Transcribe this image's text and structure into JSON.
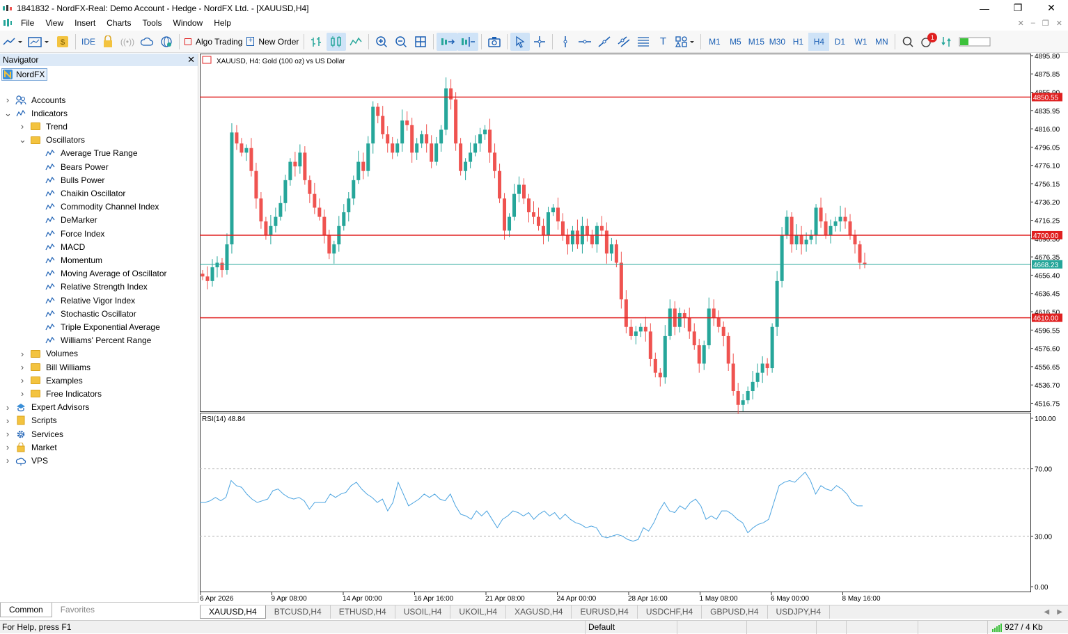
{
  "window": {
    "title": "1841832 - NordFX-Real: Demo Account - Hedge - NordFX Ltd. - [XAUUSD,H4]"
  },
  "menu": [
    "File",
    "View",
    "Insert",
    "Charts",
    "Tools",
    "Window",
    "Help"
  ],
  "toolbar": {
    "ide_label": "IDE",
    "algo_trading_label": "Algo Trading",
    "new_order_label": "New Order",
    "timeframes": [
      "M1",
      "M5",
      "M15",
      "M30",
      "H1",
      "H4",
      "D1",
      "W1",
      "MN"
    ],
    "active_timeframe": "H4",
    "notifications_count": "1"
  },
  "navigator": {
    "title": "Navigator",
    "root": "NordFX",
    "items": [
      {
        "label": "Accounts",
        "level": 1,
        "icon": "accounts-icon",
        "expander": ">"
      },
      {
        "label": "Indicators",
        "level": 1,
        "icon": "indicator-icon",
        "expander": "v"
      },
      {
        "label": "Trend",
        "level": 2,
        "icon": "folder-icon",
        "expander": ">"
      },
      {
        "label": "Oscillators",
        "level": 2,
        "icon": "folder-icon",
        "expander": "v"
      },
      {
        "label": "Average True Range",
        "level": 3,
        "icon": "indicator-icon",
        "expander": ""
      },
      {
        "label": "Bears Power",
        "level": 3,
        "icon": "indicator-icon",
        "expander": ""
      },
      {
        "label": "Bulls Power",
        "level": 3,
        "icon": "indicator-icon",
        "expander": ""
      },
      {
        "label": "Chaikin Oscillator",
        "level": 3,
        "icon": "indicator-icon",
        "expander": ""
      },
      {
        "label": "Commodity Channel Index",
        "level": 3,
        "icon": "indicator-icon",
        "expander": ""
      },
      {
        "label": "DeMarker",
        "level": 3,
        "icon": "indicator-icon",
        "expander": ""
      },
      {
        "label": "Force Index",
        "level": 3,
        "icon": "indicator-icon",
        "expander": ""
      },
      {
        "label": "MACD",
        "level": 3,
        "icon": "indicator-icon",
        "expander": ""
      },
      {
        "label": "Momentum",
        "level": 3,
        "icon": "indicator-icon",
        "expander": ""
      },
      {
        "label": "Moving Average of Oscillator",
        "level": 3,
        "icon": "indicator-icon",
        "expander": ""
      },
      {
        "label": "Relative Strength Index",
        "level": 3,
        "icon": "indicator-icon",
        "expander": ""
      },
      {
        "label": "Relative Vigor Index",
        "level": 3,
        "icon": "indicator-icon",
        "expander": ""
      },
      {
        "label": "Stochastic Oscillator",
        "level": 3,
        "icon": "indicator-icon",
        "expander": ""
      },
      {
        "label": "Triple Exponential Average",
        "level": 3,
        "icon": "indicator-icon",
        "expander": ""
      },
      {
        "label": "Williams' Percent Range",
        "level": 3,
        "icon": "indicator-icon",
        "expander": ""
      },
      {
        "label": "Volumes",
        "level": 2,
        "icon": "folder-icon",
        "expander": ">"
      },
      {
        "label": "Bill Williams",
        "level": 2,
        "icon": "folder-icon",
        "expander": ">"
      },
      {
        "label": "Examples",
        "level": 2,
        "icon": "folder-icon",
        "expander": ">"
      },
      {
        "label": "Free Indicators",
        "level": 2,
        "icon": "folder-icon",
        "expander": ">"
      },
      {
        "label": "Expert Advisors",
        "level": 1,
        "icon": "expert-icon",
        "expander": ">"
      },
      {
        "label": "Scripts",
        "level": 1,
        "icon": "script-icon",
        "expander": ">"
      },
      {
        "label": "Services",
        "level": 1,
        "icon": "gear-icon",
        "expander": ">"
      },
      {
        "label": "Market",
        "level": 1,
        "icon": "bag-icon",
        "expander": ">"
      },
      {
        "label": "VPS",
        "level": 1,
        "icon": "cloud-icon",
        "expander": ">"
      }
    ],
    "tabs": [
      "Common",
      "Favorites"
    ]
  },
  "chart": {
    "header": "XAUUSD, H4:  Gold (100 oz) vs US Dollar",
    "rsi_label": "RSI(14) 48.84",
    "price_axis": [
      "4895.80",
      "4875.85",
      "4855.90",
      "4835.95",
      "4816.00",
      "4796.05",
      "4776.10",
      "4756.15",
      "4736.20",
      "4716.25",
      "4696.30",
      "4676.35",
      "4656.40",
      "4636.45",
      "4616.50",
      "4596.55",
      "4576.60",
      "4556.65",
      "4536.70",
      "4516.75"
    ],
    "rsi_axis": [
      "100.00",
      "70.00",
      "30.00",
      "0.00"
    ],
    "time_axis": [
      "6 Apr 2026",
      "9 Apr 08:00",
      "14 Apr 00:00",
      "16 Apr 16:00",
      "21 Apr 08:00",
      "24 Apr 00:00",
      "28 Apr 16:00",
      "1 May 08:00",
      "6 May 00:00",
      "8 May 16:00"
    ],
    "hlines": [
      {
        "label": "4850.55",
        "price": 4850.55,
        "color": "#e02020"
      },
      {
        "label": "4700.00",
        "price": 4700.0,
        "color": "#e02020"
      },
      {
        "label": "4610.00",
        "price": 4610.0,
        "color": "#e02020"
      }
    ],
    "bid_line": {
      "label": "4668.23",
      "price": 4668.23,
      "color": "#26a69a"
    },
    "colors": {
      "up": "#26a69a",
      "down": "#ef5350",
      "rsi": "#4aa3e0"
    }
  },
  "chart_data": {
    "type": "candlestick",
    "symbol": "XAUUSD",
    "timeframe": "H4",
    "ylim": [
      4508,
      4898
    ],
    "close_path": [
      4655,
      4650,
      4665,
      4670,
      4662,
      4690,
      4812,
      4800,
      4790,
      4795,
      4770,
      4740,
      4715,
      4700,
      4710,
      4720,
      4735,
      4760,
      4780,
      4775,
      4790,
      4760,
      4745,
      4730,
      4720,
      4700,
      4680,
      4690,
      4710,
      4725,
      4740,
      4760,
      4780,
      4770,
      4800,
      4840,
      4830,
      4810,
      4800,
      4790,
      4800,
      4825,
      4820,
      4790,
      4800,
      4810,
      4800,
      4780,
      4800,
      4815,
      4860,
      4848,
      4800,
      4770,
      4780,
      4790,
      4800,
      4810,
      4815,
      4790,
      4770,
      4740,
      4705,
      4720,
      4745,
      4755,
      4740,
      4725,
      4720,
      4710,
      4700,
      4725,
      4730,
      4715,
      4700,
      4690,
      4705,
      4690,
      4710,
      4700,
      4690,
      4710,
      4705,
      4680,
      4690,
      4670,
      4630,
      4600,
      4590,
      4595,
      4600,
      4595,
      4565,
      4550,
      4545,
      4590,
      4620,
      4600,
      4615,
      4610,
      4595,
      4580,
      4560,
      4580,
      4620,
      4610,
      4600,
      4590,
      4560,
      4530,
      4515,
      4520,
      4530,
      4540,
      4550,
      4560,
      4555,
      4600,
      4650,
      4700,
      4720,
      4690,
      4700,
      4690,
      4695,
      4700,
      4730,
      4715,
      4700,
      4710,
      4715,
      4720,
      4715,
      4700,
      4690,
      4670,
      4668
    ],
    "rsi_values": [
      50,
      50,
      51,
      53,
      51,
      53,
      63,
      60,
      59,
      55,
      52,
      50,
      51,
      52,
      57,
      58,
      55,
      53,
      52,
      53,
      51,
      46,
      50,
      50,
      50,
      55,
      53,
      55,
      56,
      60,
      62,
      58,
      55,
      53,
      50,
      52,
      45,
      50,
      62,
      55,
      48,
      50,
      52,
      55,
      53,
      55,
      52,
      51,
      55,
      48,
      43,
      42,
      40,
      45,
      42,
      45,
      40,
      35,
      40,
      42,
      45,
      44,
      42,
      44,
      40,
      43,
      45,
      42,
      44,
      40,
      43,
      40,
      38,
      37,
      35,
      36,
      35,
      30,
      29,
      30,
      31,
      30,
      28,
      27,
      28,
      35,
      33,
      38,
      45,
      50,
      45,
      44,
      48,
      46,
      50,
      52,
      48,
      40,
      42,
      40,
      45,
      45,
      43,
      40,
      38,
      32,
      35,
      37,
      38,
      40,
      50,
      60,
      62,
      63,
      62,
      65,
      68,
      63,
      55,
      60,
      58,
      57,
      60,
      58,
      55,
      50,
      48,
      48
    ],
    "rsi_ylim": [
      0,
      100
    ],
    "rsi_levels": [
      70,
      30
    ]
  },
  "symbol_tabs": [
    "XAUUSD,H4",
    "BTCUSD,H4",
    "ETHUSD,H4",
    "USOIL,H4",
    "UKOIL,H4",
    "XAGUSD,H4",
    "EURUSD,H4",
    "USDCHF,H4",
    "GBPUSD,H4",
    "USDJPY,H4"
  ],
  "statusbar": {
    "help": "For Help, press F1",
    "profile": "Default",
    "traffic": "927 / 4 Kb"
  }
}
